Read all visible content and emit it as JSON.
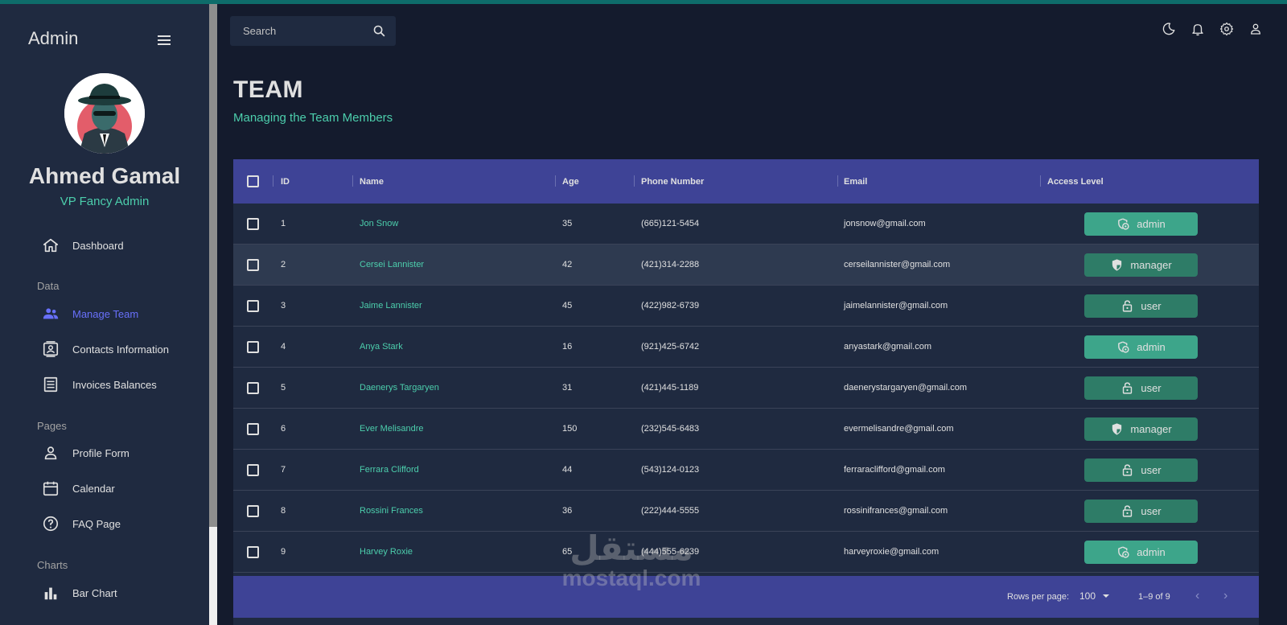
{
  "sidebar": {
    "app_title": "Admin",
    "user_name": "Ahmed Gamal",
    "user_role": "VP Fancy Admin",
    "items": [
      {
        "label": "Dashboard",
        "icon": "home-icon"
      },
      {
        "section": "Data"
      },
      {
        "label": "Manage Team",
        "icon": "people-icon",
        "active": true
      },
      {
        "label": "Contacts Information",
        "icon": "contacts-icon"
      },
      {
        "label": "Invoices Balances",
        "icon": "receipt-icon"
      },
      {
        "section": "Pages"
      },
      {
        "label": "Profile Form",
        "icon": "person-icon"
      },
      {
        "label": "Calendar",
        "icon": "calendar-icon"
      },
      {
        "label": "FAQ Page",
        "icon": "help-icon"
      },
      {
        "section": "Charts"
      },
      {
        "label": "Bar Chart",
        "icon": "bar-chart-icon"
      }
    ]
  },
  "topbar": {
    "search_placeholder": "Search",
    "icons": [
      "dark-mode-icon",
      "notifications-icon",
      "settings-icon",
      "profile-icon"
    ]
  },
  "header": {
    "title": "TEAM",
    "subtitle": "Managing the Team Members"
  },
  "table": {
    "columns": [
      "ID",
      "Name",
      "Age",
      "Phone Number",
      "Email",
      "Access Level"
    ],
    "rows": [
      {
        "id": "1",
        "name": "Jon Snow",
        "age": "35",
        "phone": "(665)121-5454",
        "email": "jonsnow@gmail.com",
        "access": "admin"
      },
      {
        "id": "2",
        "name": "Cersei Lannister",
        "age": "42",
        "phone": "(421)314-2288",
        "email": "cerseilannister@gmail.com",
        "access": "manager"
      },
      {
        "id": "3",
        "name": "Jaime Lannister",
        "age": "45",
        "phone": "(422)982-6739",
        "email": "jaimelannister@gmail.com",
        "access": "user"
      },
      {
        "id": "4",
        "name": "Anya Stark",
        "age": "16",
        "phone": "(921)425-6742",
        "email": "anyastark@gmail.com",
        "access": "admin"
      },
      {
        "id": "5",
        "name": "Daenerys Targaryen",
        "age": "31",
        "phone": "(421)445-1189",
        "email": "daenerystargaryen@gmail.com",
        "access": "user"
      },
      {
        "id": "6",
        "name": "Ever Melisandre",
        "age": "150",
        "phone": "(232)545-6483",
        "email": "evermelisandre@gmail.com",
        "access": "manager"
      },
      {
        "id": "7",
        "name": "Ferrara Clifford",
        "age": "44",
        "phone": "(543)124-0123",
        "email": "ferraraclifford@gmail.com",
        "access": "user"
      },
      {
        "id": "8",
        "name": "Rossini Frances",
        "age": "36",
        "phone": "(222)444-5555",
        "email": "rossinifrances@gmail.com",
        "access": "user"
      },
      {
        "id": "9",
        "name": "Harvey Roxie",
        "age": "65",
        "phone": "(444)555-6239",
        "email": "harveyroxie@gmail.com",
        "access": "admin"
      }
    ],
    "footer": {
      "rows_per_page_label": "Rows per page:",
      "rows_per_page_value": "100",
      "range": "1–9 of 9"
    }
  },
  "watermark": {
    "arabic": "مستقل",
    "latin": "mostaql.com"
  },
  "colors": {
    "accent_green": "#4cceac",
    "header_blue": "#3e4396",
    "sidebar_bg": "#1f2a40",
    "page_bg": "#141b2d",
    "active_purple": "#6870fa"
  }
}
